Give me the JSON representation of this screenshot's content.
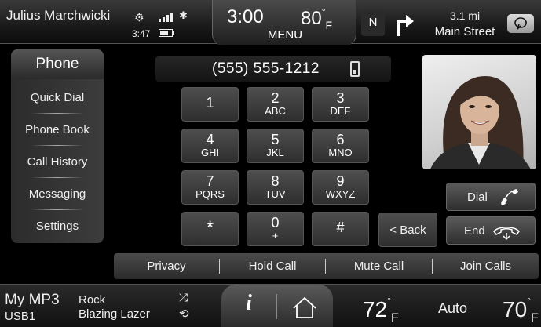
{
  "status": {
    "user_name": "Julius Marchwicki",
    "phone_time": "3:47"
  },
  "center": {
    "clock": "3:00",
    "outside_temp": "80",
    "outside_unit": "F",
    "menu_label": "MENU"
  },
  "navigation": {
    "compass": "N",
    "distance": "3.1 mi",
    "street": "Main Street"
  },
  "left_nav": {
    "header": "Phone",
    "items": [
      {
        "label": "Quick Dial"
      },
      {
        "label": "Phone Book"
      },
      {
        "label": "Call History"
      },
      {
        "label": "Messaging"
      },
      {
        "label": "Settings"
      }
    ]
  },
  "dialer": {
    "number": "(555) 555-1212",
    "keys": [
      {
        "digit": "1",
        "letters": ""
      },
      {
        "digit": "2",
        "letters": "ABC"
      },
      {
        "digit": "3",
        "letters": "DEF"
      },
      {
        "digit": "4",
        "letters": "GHI"
      },
      {
        "digit": "5",
        "letters": "JKL"
      },
      {
        "digit": "6",
        "letters": "MNO"
      },
      {
        "digit": "7",
        "letters": "PQRS"
      },
      {
        "digit": "8",
        "letters": "TUV"
      },
      {
        "digit": "9",
        "letters": "WXYZ"
      },
      {
        "digit": "*",
        "letters": ""
      },
      {
        "digit": "0",
        "letters": "+"
      },
      {
        "digit": "#",
        "letters": ""
      }
    ],
    "back_label": "< Back",
    "dial_label": "Dial",
    "end_label": "End"
  },
  "call_options": [
    "Privacy",
    "Hold Call",
    "Mute Call",
    "Join Calls"
  ],
  "media": {
    "source": "My MP3",
    "device": "USB1",
    "genre": "Rock",
    "artist": "Blazing Lazer"
  },
  "climate": {
    "driver_temp": "72",
    "driver_unit": "F",
    "mode": "Auto",
    "passenger_temp": "70",
    "passenger_unit": "F"
  },
  "colors": {
    "background": "#000000",
    "accent_text": "#ffffff",
    "button_top": "#4e4e4e",
    "button_bottom": "#2e2e2e"
  }
}
